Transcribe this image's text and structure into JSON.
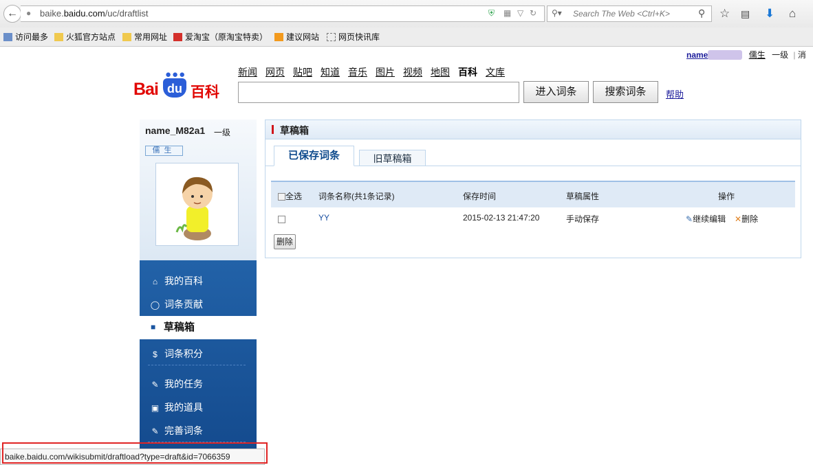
{
  "browser": {
    "url_prefix": "baike.",
    "url_host": "baidu.com",
    "url_path": "/uc/draftlist",
    "search_placeholder": "Search The Web <Ctrl+K>",
    "bookmarks": [
      "访问最多",
      "火狐官方站点",
      "常用网址",
      "爱淘宝（原淘宝特卖）",
      "建议网站",
      "网页快讯库"
    ]
  },
  "userbar": {
    "name": "name",
    "role": "儒生",
    "level": "一级",
    "more": "消"
  },
  "header": {
    "logo_bai": "Bai",
    "logo_du": "du",
    "logo_baike": "百科",
    "nav": [
      "新闻",
      "网页",
      "贴吧",
      "知道",
      "音乐",
      "图片",
      "视频",
      "地图"
    ],
    "nav_current": "百科",
    "nav_last": "文库",
    "enter_button": "进入词条",
    "search_button": "搜索词条",
    "help": "帮助"
  },
  "sidebar": {
    "username": "name_M82a1",
    "level": "一级",
    "badge": "儒生",
    "items": [
      {
        "label": "我的百科",
        "icon": "home-icon"
      },
      {
        "label": "词条贡献",
        "icon": "bulb-icon"
      },
      {
        "label": "草稿箱",
        "icon": "draft-icon",
        "active": true
      },
      {
        "label": "词条积分",
        "icon": "coin-icon"
      },
      {
        "label": "我的任务",
        "icon": "task-icon"
      },
      {
        "label": "我的道具",
        "icon": "tool-icon"
      },
      {
        "label": "完善词条",
        "icon": "edit-icon"
      }
    ]
  },
  "panel": {
    "title": "草稿箱",
    "tabs": [
      "已保存词条",
      "旧草稿箱"
    ],
    "columns": {
      "select_all": "全选",
      "name": "词条名称(共1条记录)",
      "time": "保存时间",
      "attr": "草稿属性",
      "action": "操作"
    },
    "rows": [
      {
        "name": "YY",
        "time": "2015-02-13 21:47:20",
        "attr": "手动保存",
        "edit": "继续编辑",
        "delete": "删除"
      }
    ],
    "delete_button": "删除"
  },
  "statusbar": {
    "link": "baike.baidu.com/wikisubmit/draftload?type=draft&id=7066359"
  },
  "colors": {
    "accent_red": "#e10602",
    "baidu_blue": "#2b5ed8",
    "sidebar_blue": "#1a55a0",
    "highlight_red": "#e02424"
  }
}
